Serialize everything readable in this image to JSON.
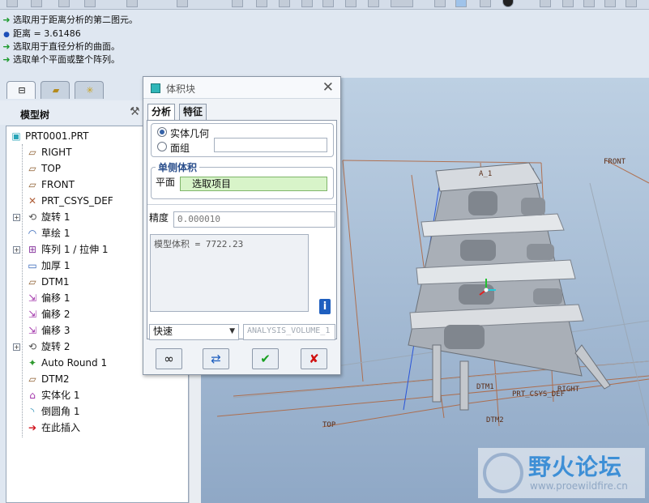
{
  "messages": [
    {
      "icon": "arrow-icon",
      "text": "选取用于距离分析的第二图元。"
    },
    {
      "icon": "dot-icon",
      "text": "距离 = 3.61486"
    },
    {
      "icon": "arrow-icon",
      "text": "选取用于直径分析的曲面。"
    },
    {
      "icon": "arrow-icon",
      "text": "选取单个平面或整个阵列。"
    }
  ],
  "model_tree": {
    "title": "模型树",
    "items": [
      {
        "label": "PRT0001.PRT",
        "icon": "part-icon"
      },
      {
        "label": "RIGHT",
        "icon": "datum-plane-icon"
      },
      {
        "label": "TOP",
        "icon": "datum-plane-icon"
      },
      {
        "label": "FRONT",
        "icon": "datum-plane-icon"
      },
      {
        "label": "PRT_CSYS_DEF",
        "icon": "csys-icon"
      },
      {
        "label": "旋转 1",
        "icon": "revolve-icon",
        "expandable": true
      },
      {
        "label": "草绘 1",
        "icon": "sketch-icon"
      },
      {
        "label": "阵列 1 / 拉伸 1",
        "icon": "pattern-icon",
        "expandable": true
      },
      {
        "label": "加厚 1",
        "icon": "thicken-icon"
      },
      {
        "label": "DTM1",
        "icon": "datum-plane-icon"
      },
      {
        "label": "偏移 1",
        "icon": "offset-icon"
      },
      {
        "label": "偏移 2",
        "icon": "offset-icon"
      },
      {
        "label": "偏移 3",
        "icon": "offset-icon"
      },
      {
        "label": "旋转 2",
        "icon": "revolve-icon",
        "expandable": true
      },
      {
        "label": "Auto Round 1",
        "icon": "auto-round-icon"
      },
      {
        "label": "DTM2",
        "icon": "datum-plane-icon"
      },
      {
        "label": "实体化 1",
        "icon": "solidify-icon"
      },
      {
        "label": "倒圆角 1",
        "icon": "round-icon"
      },
      {
        "label": "在此插入",
        "icon": "insert-here-icon"
      }
    ]
  },
  "dialog": {
    "title": "体积块",
    "tabs": [
      "分析",
      "特征"
    ],
    "radio_solid": "实体几何",
    "radio_quilt": "面组",
    "group_title": "单侧体积",
    "plane_label": "平面",
    "plane_value": "选取项目",
    "precision_label": "精度",
    "precision_value": "0.000010",
    "result_text": "模型体积 = 7722.23",
    "mode_value": "快速",
    "feature_name": "ANALYSIS_VOLUME_1"
  },
  "viewport": {
    "labels": {
      "front": "FRONT",
      "top": "TOP",
      "right": "RIGHT",
      "dtm1": "DTM1",
      "dtm2": "DTM2",
      "csys": "PRT_CSYS_DEF",
      "axis_a1": "A_1"
    }
  },
  "watermark": {
    "name": "野火论坛",
    "url": "www.proewildfire.cn"
  }
}
